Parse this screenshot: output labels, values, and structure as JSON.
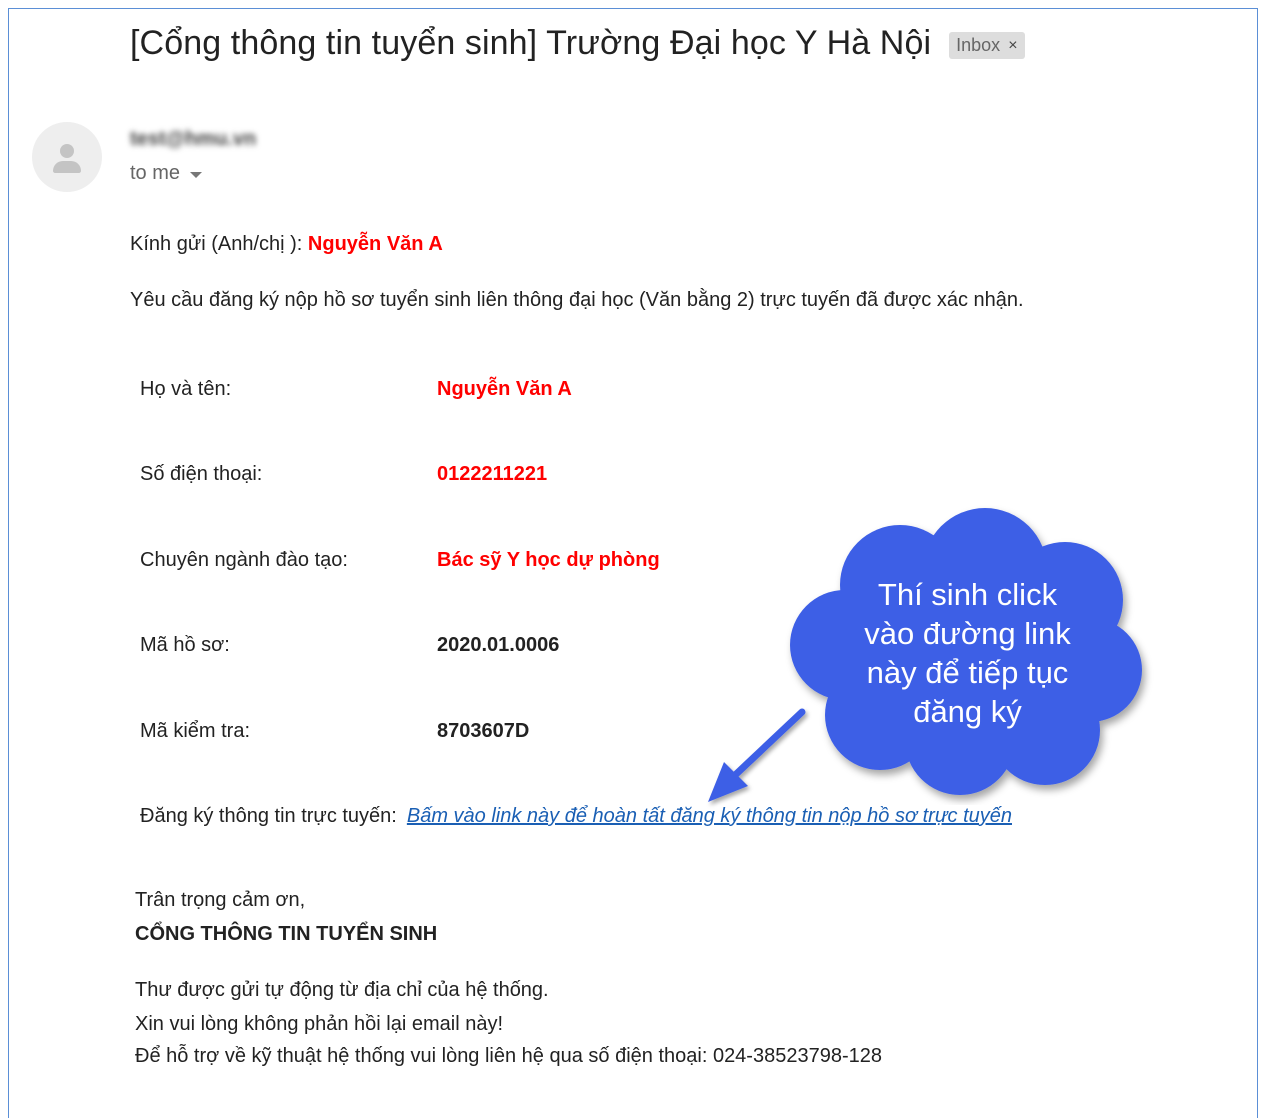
{
  "email": {
    "subject": "[Cổng thông tin tuyển sinh] Trường Đại học Y Hà Nội",
    "label": "Inbox",
    "label_close": "×",
    "sender": "test@hmu.vn",
    "recipient": "to me",
    "greeting_prefix": "Kính gửi (Anh/chị ): ",
    "greeting_name": "Nguyễn Văn A",
    "intro": "Yêu cầu đăng ký nộp hồ sơ tuyển sinh liên thông đại học (Văn bằng 2) trực tuyến đã được xác nhận."
  },
  "fields": {
    "name_label": "Họ và tên:",
    "name_value": "Nguyễn Văn A",
    "phone_label": "Số điện thoại:",
    "phone_value": "0122211221",
    "major_label": "Chuyên ngành đào tạo:",
    "major_value": "Bác sỹ Y học dự phòng",
    "dossier_label": "Mã hồ sơ:",
    "dossier_value": "2020.01.0006",
    "check_label": "Mã kiểm tra:",
    "check_value": "8703607D"
  },
  "registration": {
    "label": "Đăng ký thông tin trực tuyến:",
    "link_text": "Bấm vào link này để hoàn tất đăng ký thông tin nộp hồ sơ trực tuyến"
  },
  "signature": {
    "thanks": "Trân trọng cảm ơn,",
    "org": "CỔNG THÔNG TIN TUYỂN SINH",
    "note1": "Thư được gửi tự động từ địa chỉ của hệ thống.",
    "note2": "Xin vui lòng không phản hồi lại email này!",
    "note3": "Để hỗ trợ về kỹ thuật hệ thống vui lòng liên hệ qua số điện thoại: 024-38523798-128"
  },
  "callout": {
    "line1": "Thí sinh click",
    "line2": "vào đường link",
    "line3": "này để tiếp tục",
    "line4": "đăng ký",
    "fill_color": "#3d5fe6"
  },
  "colors": {
    "highlight": "#ff0000",
    "link": "#1a5fb4",
    "frame_border": "#5b8fd6"
  }
}
